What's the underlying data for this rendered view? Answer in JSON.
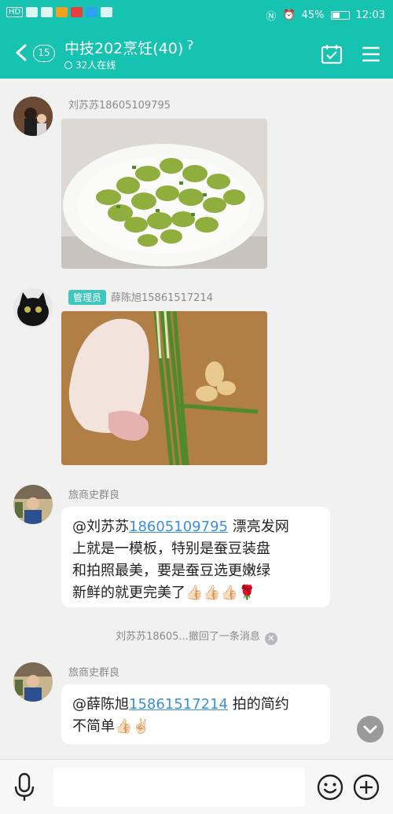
{
  "status_bar": {
    "left_text": "HD",
    "battery": "45%",
    "time": "12:03"
  },
  "header": {
    "unread_count": "15",
    "title": "中技202烹饪(40)",
    "online_text": "32人在线"
  },
  "messages": [
    {
      "type": "image",
      "sender": "刘苏苏18605109795",
      "image_desc": "green-fava-beans-dish"
    },
    {
      "type": "image",
      "sender": "薛陈旭15861517214",
      "badge": "管理员",
      "image_desc": "chicken-leg-scallion-ginger"
    },
    {
      "type": "text",
      "sender": "旅商史群良",
      "mention_name": "@刘苏苏",
      "mention_number": "18605109795",
      "line1_rest": " 漂亮发网",
      "line2": "上就是一模板，特别是蚕豆装盘",
      "line3": "和拍照最美，要是蚕豆选更嫩绿",
      "line4": "新鲜的就更完美了👍🏻👍🏻👍🏻🌹"
    },
    {
      "type": "recall",
      "text": "刘苏苏18605...撤回了一条消息"
    },
    {
      "type": "text",
      "sender": "旅商史群良",
      "mention_name": "@薛陈旭",
      "mention_number": "15861517214",
      "line1_rest": " 拍的简约",
      "line2": "不简单👍🏻✌🏻"
    }
  ],
  "input": {
    "placeholder": ""
  },
  "icons": [
    "back-icon",
    "calendar-check-icon",
    "menu-icon",
    "microphone-icon",
    "emoji-icon",
    "plus-icon",
    "ear-icon",
    "scroll-down-icon"
  ]
}
